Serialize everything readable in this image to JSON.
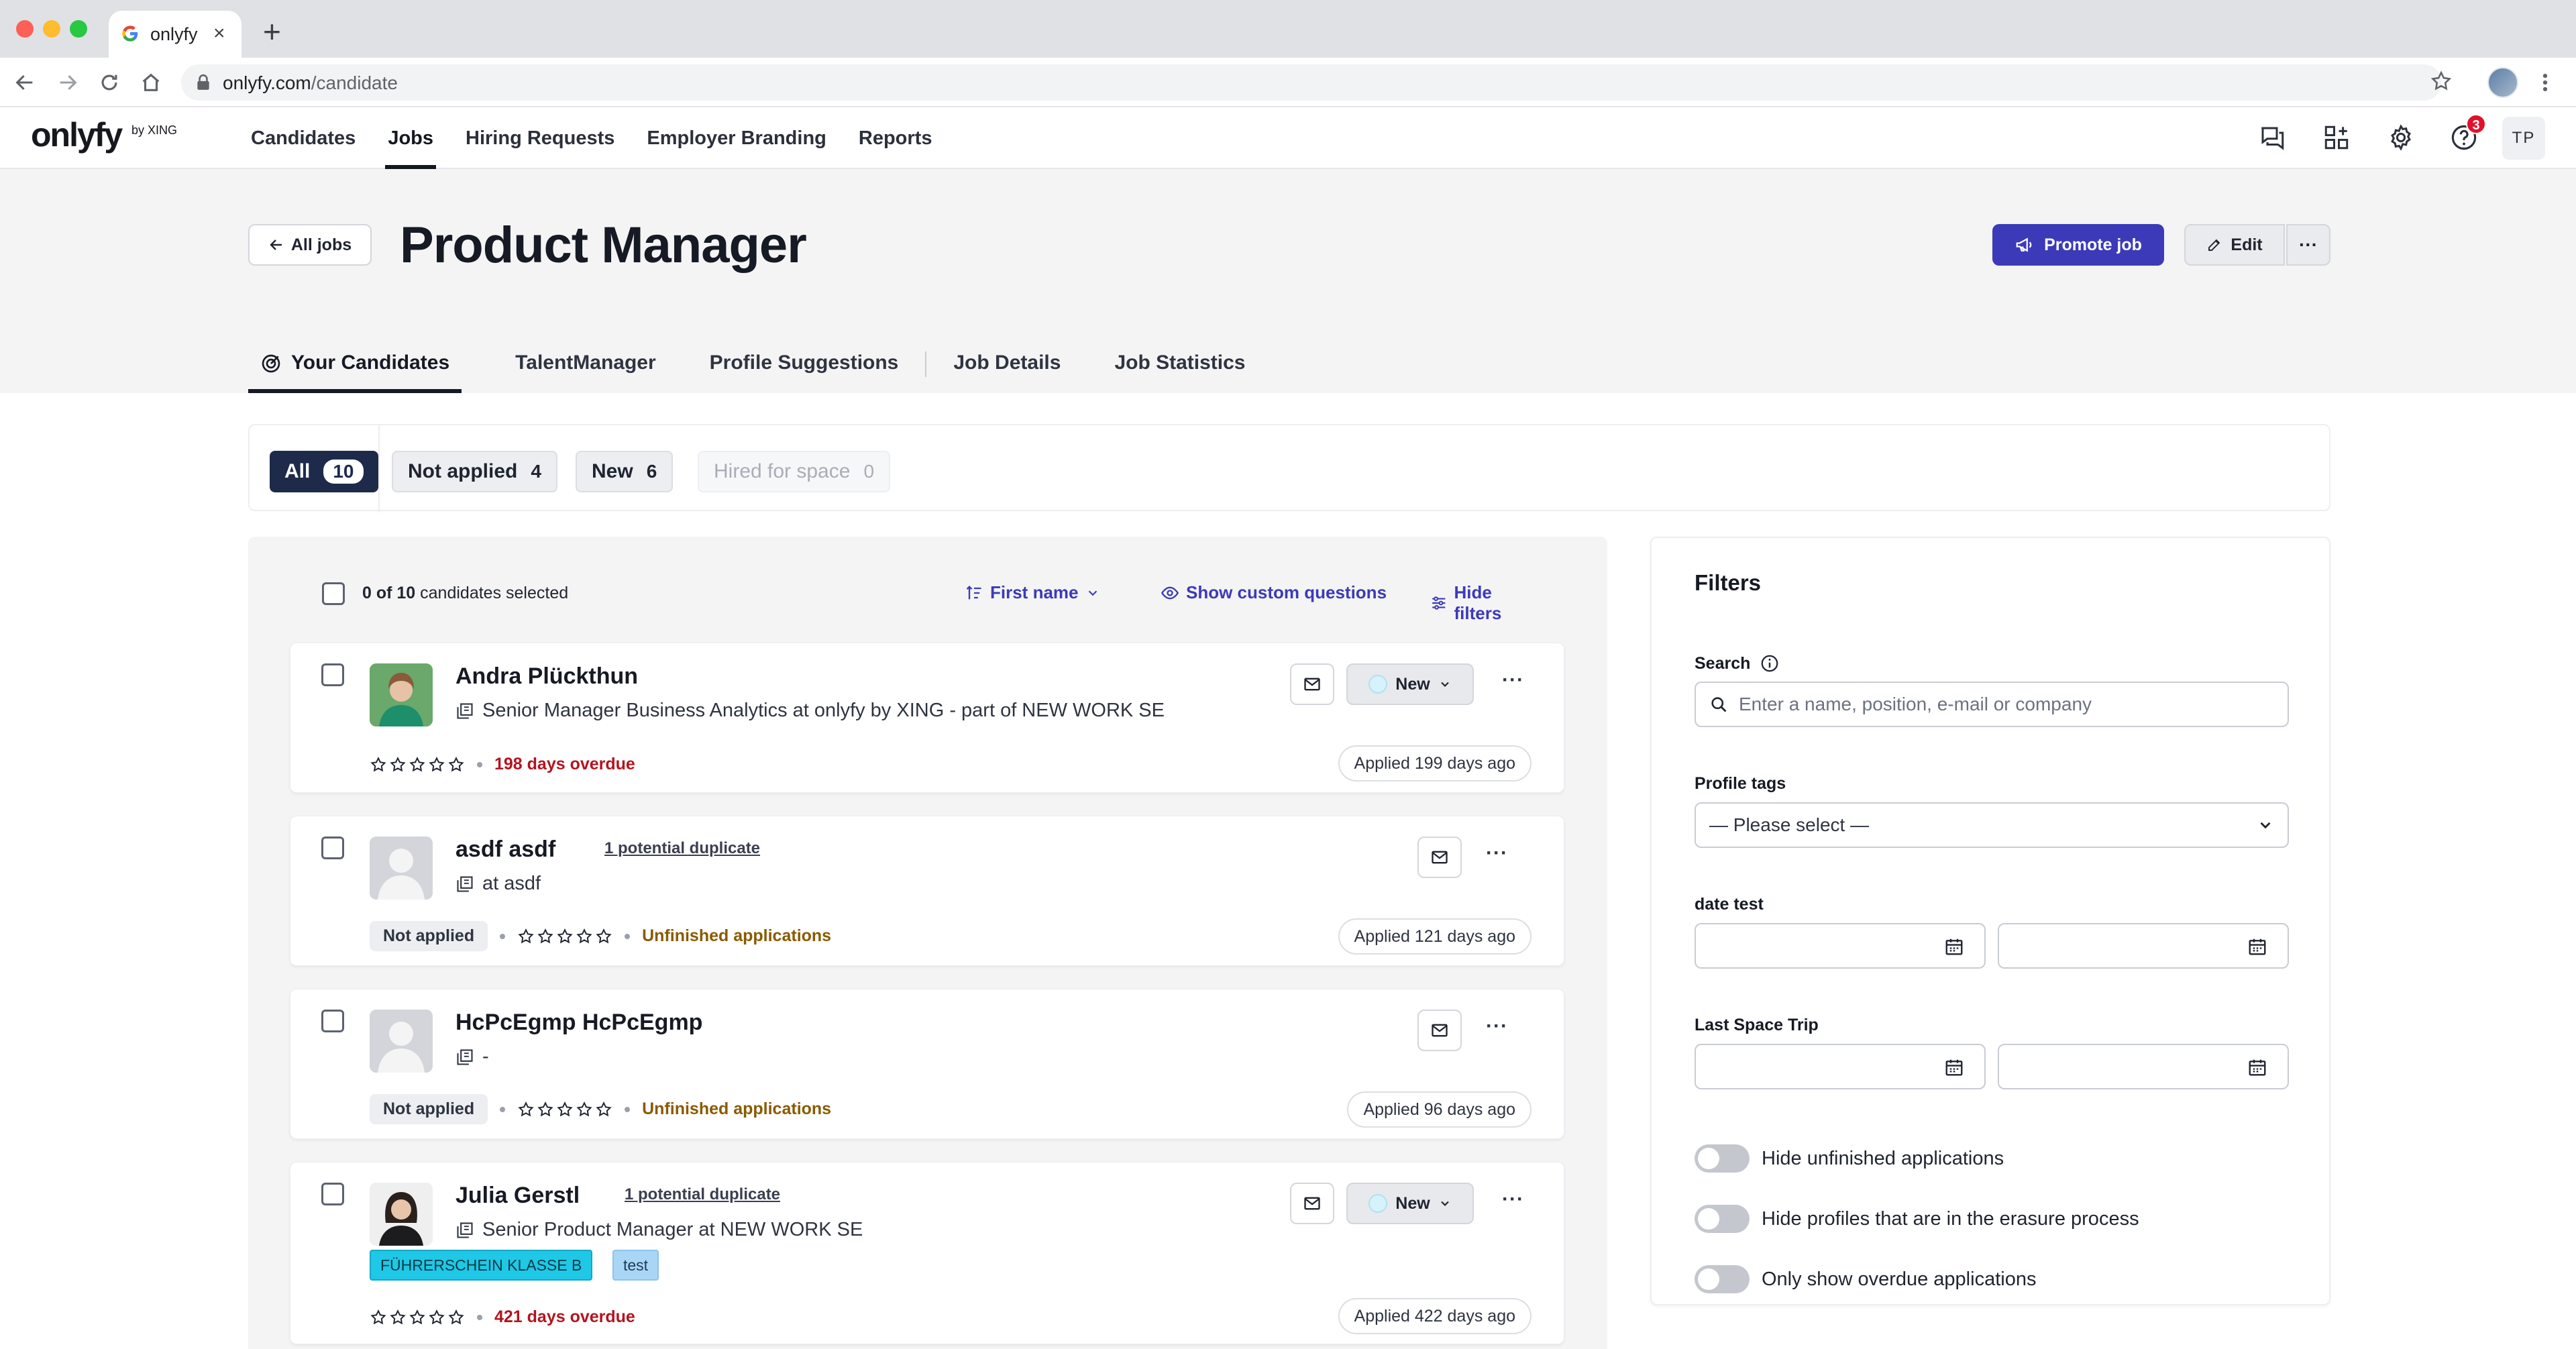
{
  "browser": {
    "tab_title": "onlyfy",
    "url_host": "onlyfy.com",
    "url_path": "/candidate"
  },
  "app": {
    "logo_text": "onlyfy",
    "logo_sub": "by XING",
    "nav": [
      "Candidates",
      "Jobs",
      "Hiring Requests",
      "Employer Branding",
      "Reports"
    ],
    "active_nav": "Jobs",
    "help_badge": "3",
    "user_initials": "TP"
  },
  "job": {
    "back_label": "All jobs",
    "title": "Product Manager",
    "promote_label": "Promote job",
    "edit_label": "Edit",
    "more_label": "···"
  },
  "subtabs": [
    "Your Candidates",
    "TalentManager",
    "Profile Suggestions",
    "Job Details",
    "Job Statistics"
  ],
  "status_filter": {
    "all": {
      "label": "All",
      "count": "10"
    },
    "not_applied": {
      "label": "Not applied",
      "count": "4"
    },
    "new": {
      "label": "New",
      "count": "6"
    },
    "hired": {
      "label": "Hired for space",
      "count": "0"
    }
  },
  "toolbar": {
    "selected_count": "0 of 10",
    "selected_suffix": "candidates selected",
    "sort_label": "First name",
    "custom_questions_label": "Show custom questions",
    "hide_filters_label": "Hide filters"
  },
  "candidates": [
    {
      "name": "Andra Plückthun",
      "subtitle": "Senior Manager Business Analytics at onlyfy by XING - part of NEW WORK SE",
      "status": "New",
      "overdue": "198 days overdue",
      "applied": "Applied 199 days ago",
      "rating": 0
    },
    {
      "name": "asdf asdf",
      "duplicate": "1 potential duplicate",
      "subtitle": "at asdf",
      "state": "Not applied",
      "unfinished": "Unfinished applications",
      "applied": "Applied 121 days ago",
      "rating": 0
    },
    {
      "name": "HcPcEgmp HcPcEgmp",
      "subtitle": "-",
      "state": "Not applied",
      "unfinished": "Unfinished applications",
      "applied": "Applied 96 days ago",
      "rating": 0
    },
    {
      "name": "Julia Gerstl",
      "duplicate": "1 potential duplicate",
      "subtitle": "Senior Product Manager at NEW WORK SE",
      "status": "New",
      "tags": [
        "FÜHRERSCHEIN KLASSE B",
        "test"
      ],
      "overdue": "421 days overdue",
      "applied": "Applied 422 days ago",
      "rating": 0
    }
  ],
  "filters": {
    "title": "Filters",
    "search_label": "Search",
    "search_placeholder": "Enter a name, position, e-mail or company",
    "profile_tags_label": "Profile tags",
    "profile_tags_value": "— Please select —",
    "date_test_label": "date test",
    "last_space_trip_label": "Last Space Trip",
    "toggles": [
      {
        "label": "Hide unfinished applications",
        "on": false
      },
      {
        "label": "Hide profiles that are in the erasure process",
        "on": false
      },
      {
        "label": "Only show overdue applications",
        "on": false
      }
    ]
  },
  "colors": {
    "primary": "#3c3ab8",
    "navy": "#1d2a4a",
    "overdue": "#b3141f",
    "unfinished": "#8a5a00",
    "tag_cyan": "#1ec8e6",
    "tag_lightblue": "#a9d6f5"
  }
}
